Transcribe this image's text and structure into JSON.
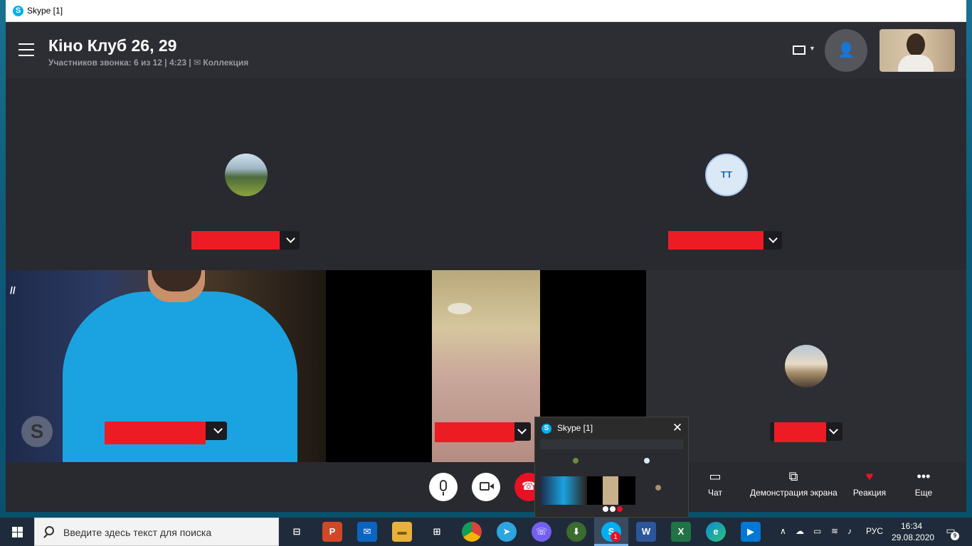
{
  "window": {
    "title": "Skype [1]",
    "logo_letter": "S"
  },
  "header": {
    "call_title": "Кіно Клуб 26, 29",
    "subtitle": "Участников звонка: 6 из 12 | 4:23 | ✉ Коллекция"
  },
  "participants": {
    "tt_initials": "TT",
    "skype_badge": "S",
    "paused_glyph": "//"
  },
  "controls": {
    "chat_label": "Чат",
    "share_label": "Демонстрация экрана",
    "reaction_label": "Реакция",
    "more_label": "Еще"
  },
  "thumbnail": {
    "title": "Skype [1]",
    "close_glyph": "✕"
  },
  "taskbar": {
    "search_placeholder": "Введите здесь текст для поиска",
    "skype_badge_count": "1",
    "language": "РУС",
    "time": "16:34",
    "date": "29.08.2020",
    "notification_count": "9"
  },
  "colors": {
    "skype_blue": "#00aff0",
    "end_call_red": "#e81123",
    "redaction_red": "#ed1c24",
    "shirt_blue": "#1aa3e0"
  },
  "icons": {
    "menu": "hamburger-icon",
    "layout": "layout-icon",
    "add_participant": "add-person-icon",
    "microphone": "microphone-icon",
    "camera": "camera-icon",
    "end_call": "end-call-icon",
    "chat": "chat-icon",
    "share": "screen-share-icon",
    "reaction": "heart-icon",
    "more": "more-icon"
  }
}
